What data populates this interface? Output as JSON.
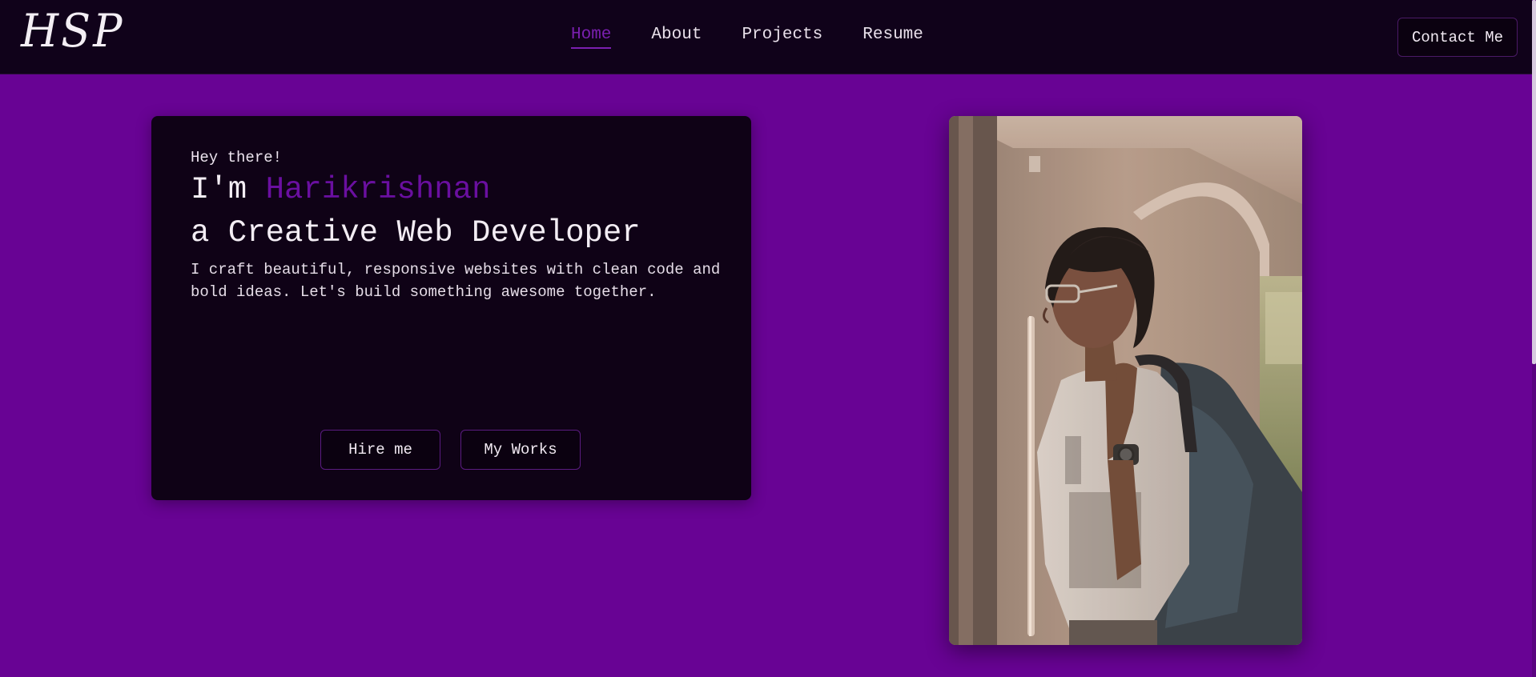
{
  "header": {
    "logo": "HSP",
    "nav": [
      {
        "label": "Home",
        "active": true
      },
      {
        "label": "About",
        "active": false
      },
      {
        "label": "Projects",
        "active": false
      },
      {
        "label": "Resume",
        "active": false
      }
    ],
    "contact_label": "Contact Me"
  },
  "intro": {
    "greeting": "Hey there!",
    "headline_prefix": "I'm ",
    "name": "Harikrishnan",
    "headline_2": "a Creative Web Developer",
    "description": "I craft beautiful, responsive websites with clean code and bold ideas. Let's build something awesome together.",
    "buttons": {
      "hire": "Hire me",
      "works": "My Works"
    }
  },
  "photo": {
    "icon": "portrait-photo"
  },
  "colors": {
    "page_bg": "#680394",
    "header_bg": "#10021a",
    "card_bg": "#0f0216",
    "accent": "#6a0fa0"
  }
}
